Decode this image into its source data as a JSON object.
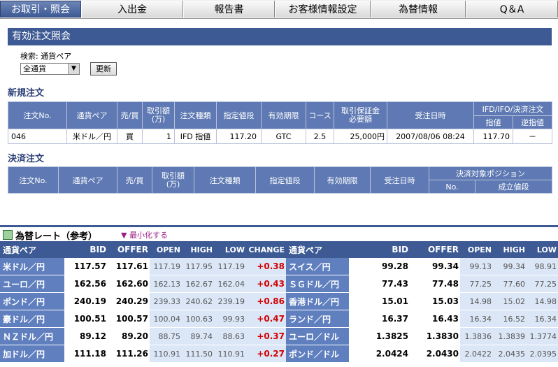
{
  "nav": {
    "tabs": [
      "お取引・照会",
      "入出金",
      "報告書",
      "お客様情報設定",
      "為替情報",
      "Q＆A"
    ]
  },
  "section_title": "有効注文照会",
  "search": {
    "label": "検索: 通貨ペア",
    "select_value": "全通貨",
    "refresh_button": "更新"
  },
  "new_orders": {
    "title": "新規注文",
    "headers": {
      "order_no": "注文No.",
      "pair": "通貨ペア",
      "side": "売/買",
      "amount": "取引額\n(万)",
      "order_type": "注文種類",
      "price": "指定値段",
      "expiry": "有効期限",
      "course": "コース",
      "margin": "取引保証金\n必要額",
      "received": "受注日時",
      "ifd_group": "IFD/IFO/決済注文",
      "limit": "指値",
      "stop": "逆指値"
    },
    "rows": [
      {
        "order_no": "046",
        "pair": "米ドル／円",
        "side": "買",
        "amount": "1",
        "order_type": "IFD 指値",
        "price": "117.20",
        "expiry": "GTC",
        "course": "2.5",
        "margin": "25,000円",
        "received": "2007/08/06 08:24",
        "limit": "117.70",
        "stop": "－"
      }
    ]
  },
  "close_orders": {
    "title": "決済注文",
    "headers": {
      "order_no": "注文No.",
      "pair": "通貨ペア",
      "side": "売/買",
      "amount": "取引額\n(万)",
      "order_type": "注文種類",
      "price": "指定値段",
      "expiry": "有効期限",
      "received": "受注日時",
      "position_group": "決済対象ポジション",
      "no": "No.",
      "fill_price": "成立値段"
    }
  },
  "rates": {
    "title": "為替レート（参考）",
    "minimize": "▼ 最小化する",
    "headers": [
      "通貨ペア",
      "BID",
      "OFFER",
      "OPEN",
      "HIGH",
      "LOW",
      "CHANGE"
    ],
    "left": [
      {
        "pair": "米ドル／円",
        "bid": "117.57",
        "offer": "117.61",
        "open": "117.19",
        "high": "117.95",
        "low": "117.19",
        "change": "+0.38"
      },
      {
        "pair": "ユーロ／円",
        "bid": "162.56",
        "offer": "162.60",
        "open": "162.13",
        "high": "162.67",
        "low": "162.04",
        "change": "+0.43"
      },
      {
        "pair": "ポンド／円",
        "bid": "240.19",
        "offer": "240.29",
        "open": "239.33",
        "high": "240.62",
        "low": "239.19",
        "change": "+0.86"
      },
      {
        "pair": "豪ドル／円",
        "bid": "100.51",
        "offer": "100.57",
        "open": "100.04",
        "high": "100.63",
        "low": "99.93",
        "change": "+0.47"
      },
      {
        "pair": "ＮＺドル／円",
        "bid": "89.12",
        "offer": "89.20",
        "open": "88.75",
        "high": "89.74",
        "low": "88.63",
        "change": "+0.37"
      },
      {
        "pair": "加ドル／円",
        "bid": "111.18",
        "offer": "111.26",
        "open": "110.91",
        "high": "111.50",
        "low": "110.91",
        "change": "+0.27"
      }
    ],
    "right_headers": [
      "通貨ペア",
      "BID",
      "OFFER",
      "OPEN",
      "HIGH",
      "LOW"
    ],
    "right": [
      {
        "pair": "スイス／円",
        "bid": "99.28",
        "offer": "99.34",
        "open": "99.13",
        "high": "99.34",
        "low": "98.91"
      },
      {
        "pair": "ＳＧドル／円",
        "bid": "77.43",
        "offer": "77.48",
        "open": "77.25",
        "high": "77.60",
        "low": "77.25"
      },
      {
        "pair": "香港ドル／円",
        "bid": "15.01",
        "offer": "15.03",
        "open": "14.98",
        "high": "15.02",
        "low": "14.98"
      },
      {
        "pair": "ランド／円",
        "bid": "16.37",
        "offer": "16.43",
        "open": "16.34",
        "high": "16.52",
        "low": "16.34"
      },
      {
        "pair": "ユーロ／ドル",
        "bid": "1.3825",
        "offer": "1.3830",
        "open": "1.3836",
        "high": "1.3839",
        "low": "1.3774"
      },
      {
        "pair": "ポンド／ドル",
        "bid": "2.0424",
        "offer": "2.0430",
        "open": "2.0422",
        "high": "2.0435",
        "low": "2.0395"
      }
    ]
  }
}
